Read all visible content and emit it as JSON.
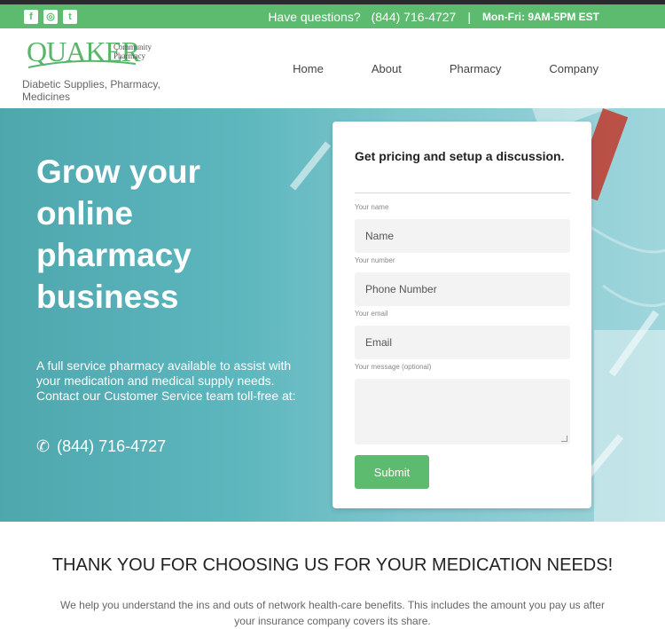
{
  "topbar": {
    "social_icons": [
      "facebook-icon",
      "instagram-icon",
      "twitter-icon"
    ],
    "question": "Have questions?",
    "phone": "(844) 716-4727",
    "separator": "|",
    "hours": "Mon-Fri: 9AM-5PM EST"
  },
  "logo": {
    "brand": "QUAKER",
    "community_line1": "Community",
    "community_line2": "Pharmacy"
  },
  "tagline": "Diabetic Supplies, Pharmacy, Medicines",
  "nav": [
    "Home",
    "About",
    "Pharmacy",
    "Company"
  ],
  "hero": {
    "title_lines": [
      "Grow your",
      "online",
      "pharmacy",
      "business"
    ],
    "description": "A full service pharmacy available to assist with your medication and medical supply needs. Contact our Customer Service team toll-free at:",
    "phone": "(844) 716-4727"
  },
  "form": {
    "title": "Get pricing and setup a discussion.",
    "name_label": "Your name",
    "name_placeholder": "Name",
    "number_label": "Your number",
    "number_placeholder": "Phone Number",
    "email_label": "Your email",
    "email_placeholder": "Email",
    "message_label": "Your message (optional)",
    "submit": "Submit"
  },
  "thanks": {
    "heading": "THANK YOU FOR CHOOSING US FOR YOUR MEDICATION NEEDS!",
    "body": "We help you understand the ins and outs of network health-care benefits. This includes the amount you pay us after your insurance company covers its share."
  },
  "colors": {
    "brand_green": "#5dbb6f",
    "hero_teal": "#5cb6bd"
  }
}
